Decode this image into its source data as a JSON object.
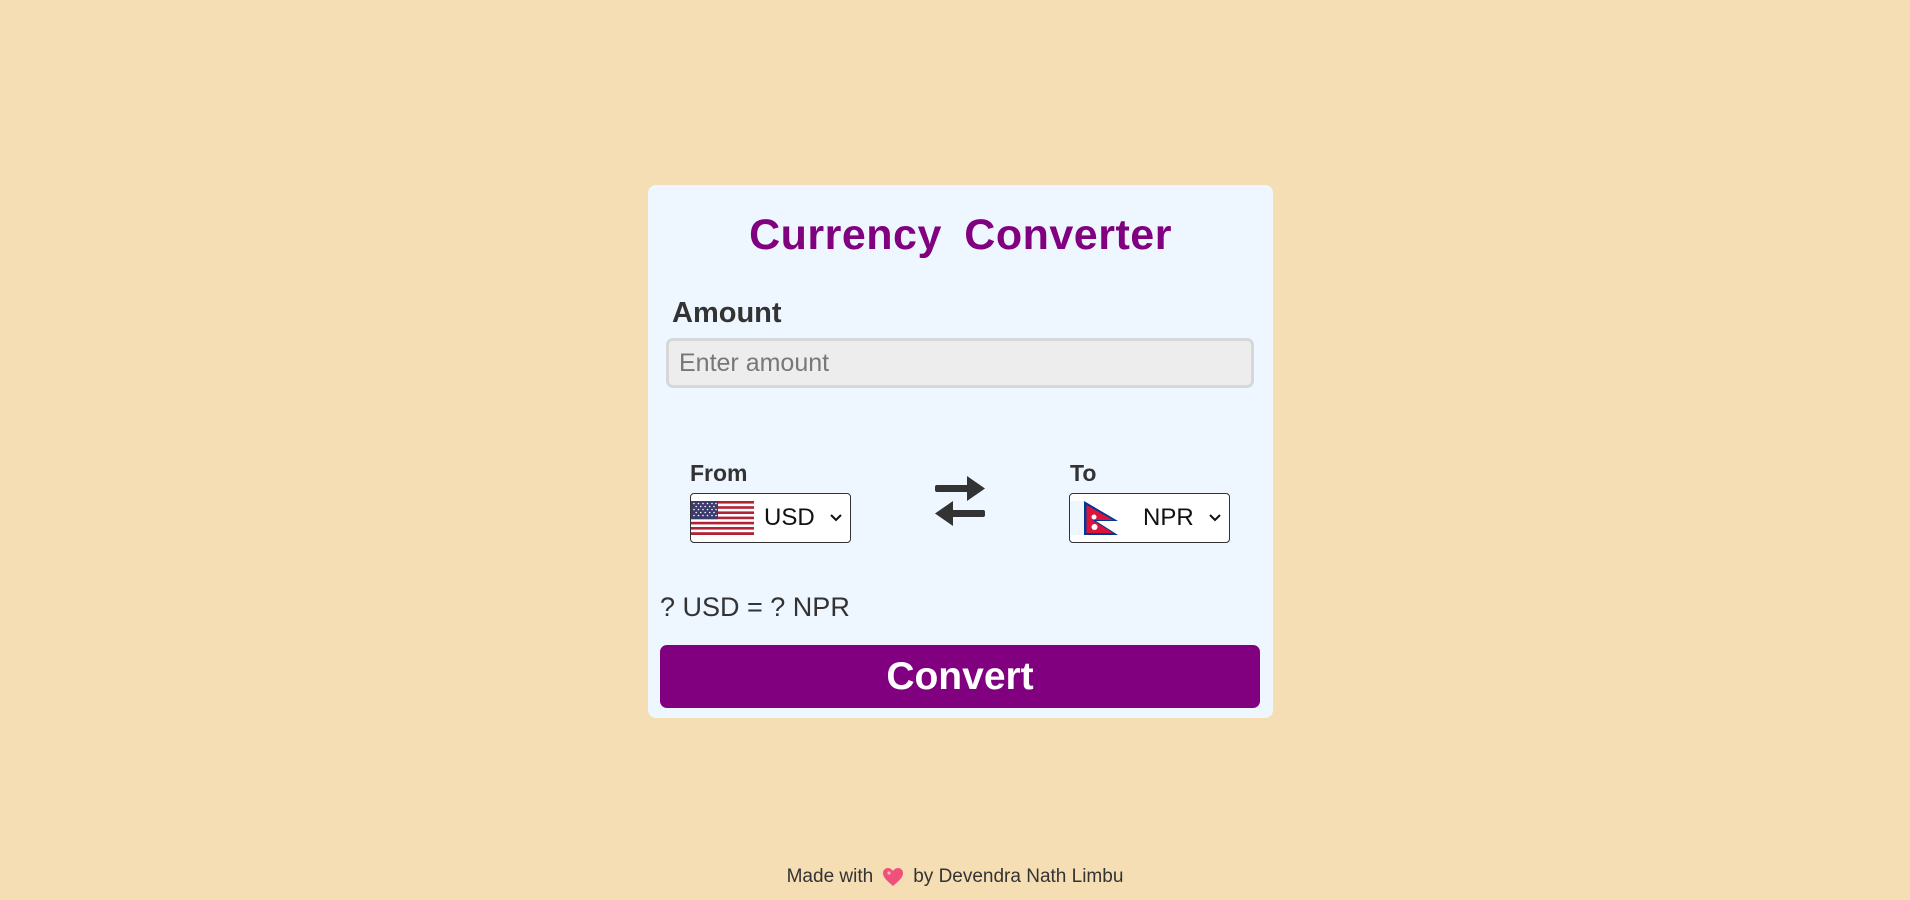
{
  "title": "Currency  Converter",
  "amount": {
    "label": "Amount",
    "placeholder": "Enter amount",
    "value": ""
  },
  "from": {
    "label": "From",
    "currency": "USD",
    "flag": "us-flag-icon"
  },
  "to": {
    "label": "To",
    "currency": "NPR",
    "flag": "np-flag-icon"
  },
  "swap_icon": "swap-arrows-icon",
  "result_text": "? USD = ? NPR",
  "convert_label": "Convert",
  "footer": {
    "prefix": "Made with",
    "icon": "heart-icon",
    "suffix": "by Devendra Nath Limbu"
  },
  "colors": {
    "background": "#f5deb3",
    "card": "#eef6ff",
    "accent": "#800080"
  }
}
